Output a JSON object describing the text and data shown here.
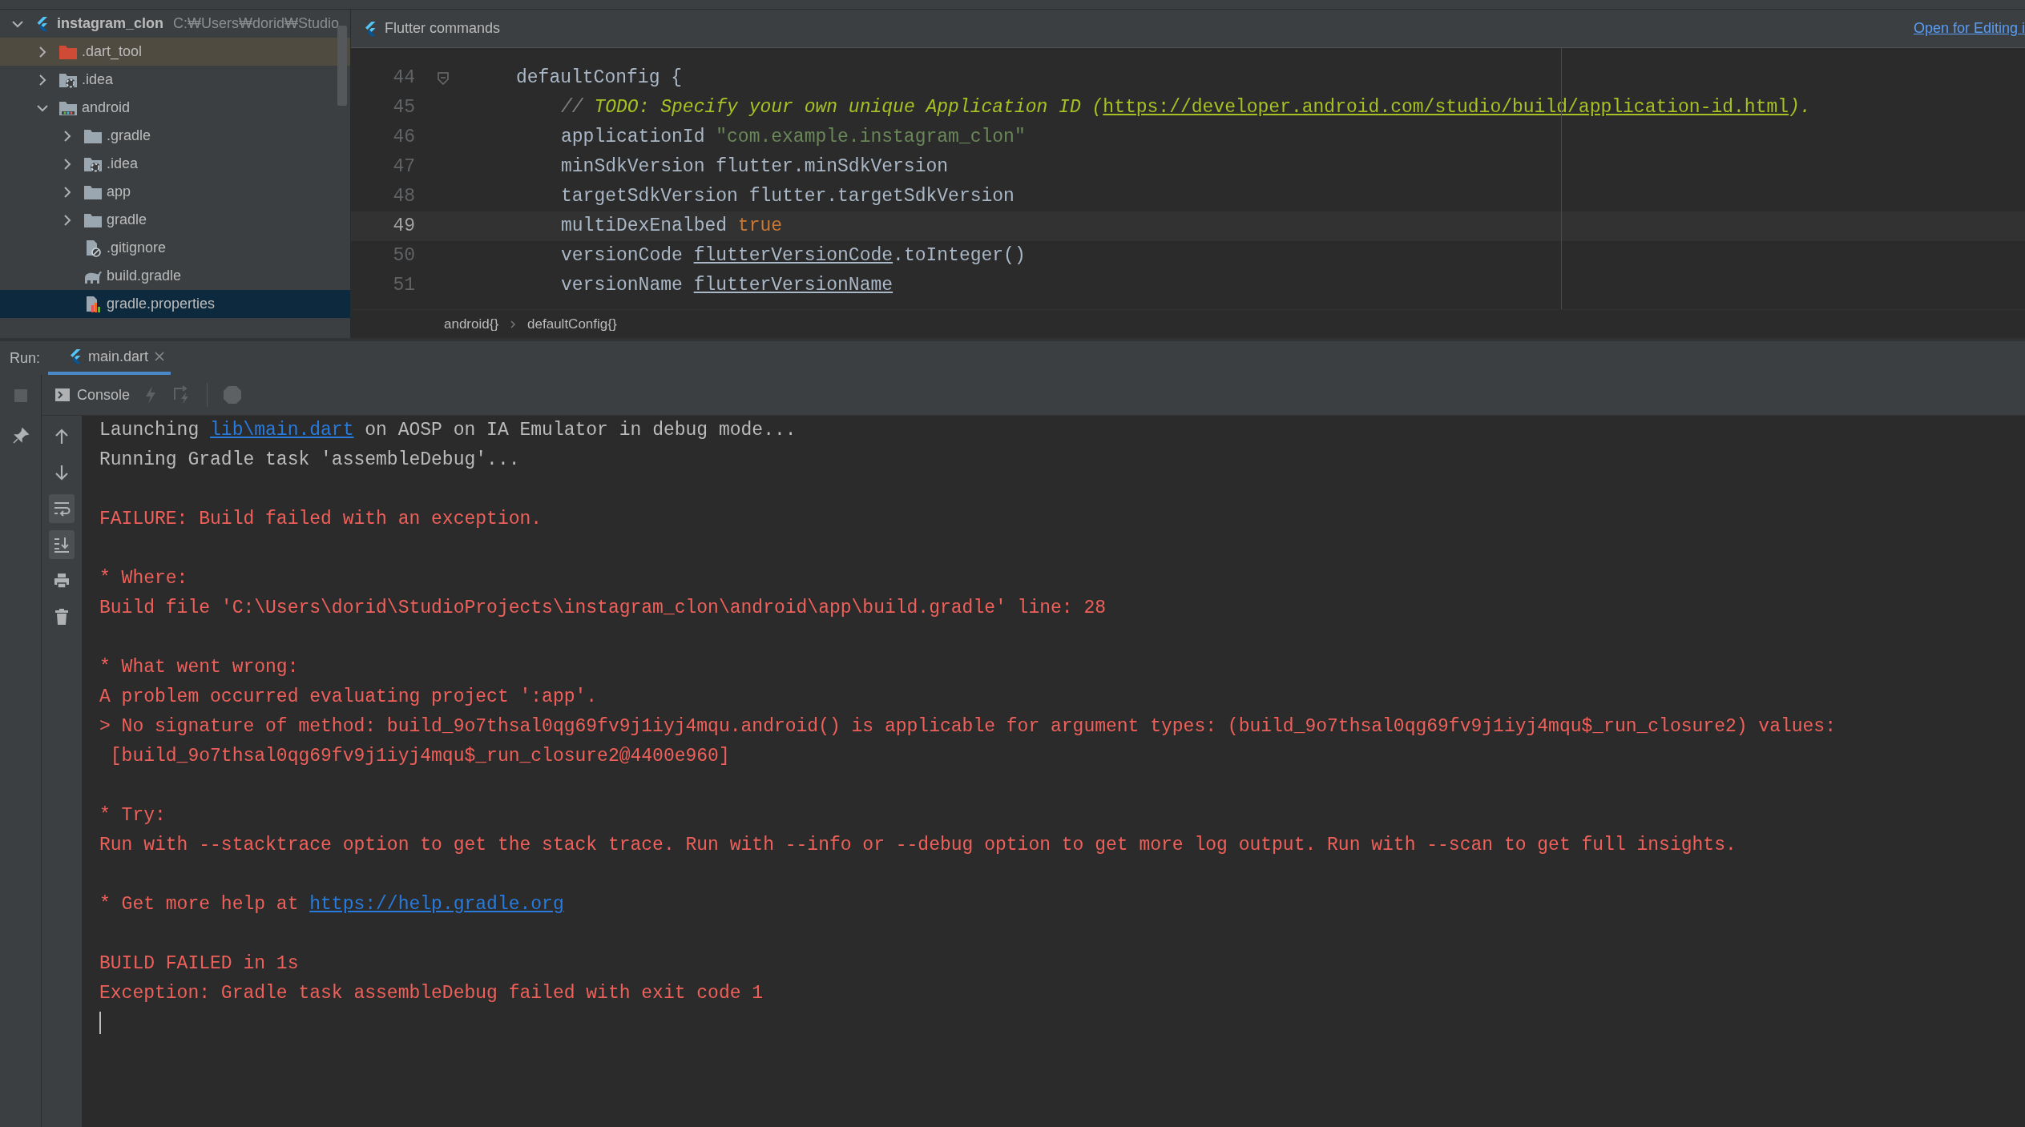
{
  "project_tree": {
    "items": [
      {
        "label": "instagram_clon",
        "path": "C:₩Users₩dorid₩Studio",
        "kind": "flutter",
        "expanded": true,
        "selected": false,
        "ignored": false,
        "children": [
          {
            "label": ".dart_tool",
            "kind": "folder-excluded",
            "expanded": false,
            "selected": false,
            "ignored": true
          },
          {
            "label": ".idea",
            "kind": "folder-idea",
            "expanded": false,
            "selected": false,
            "ignored": false
          },
          {
            "label": "android",
            "kind": "folder-android",
            "expanded": true,
            "selected": false,
            "ignored": false,
            "children": [
              {
                "label": ".gradle",
                "kind": "folder",
                "expanded": false,
                "selected": false,
                "ignored": false
              },
              {
                "label": ".idea",
                "kind": "folder-idea",
                "expanded": false,
                "selected": false,
                "ignored": false
              },
              {
                "label": "app",
                "kind": "folder",
                "expanded": false,
                "selected": false,
                "ignored": false
              },
              {
                "label": "gradle",
                "kind": "folder",
                "expanded": false,
                "selected": false,
                "ignored": false
              },
              {
                "label": ".gitignore",
                "kind": "file-ignore",
                "selected": false,
                "ignored": false
              },
              {
                "label": "build.gradle",
                "kind": "file-gradle",
                "selected": false,
                "ignored": false
              },
              {
                "label": "gradle.properties",
                "kind": "file-properties",
                "selected": true,
                "ignored": false
              }
            ]
          }
        ]
      }
    ]
  },
  "editor": {
    "toolbar": {
      "title": "Flutter commands",
      "action": "Open for Editing i"
    },
    "lines": [
      {
        "number": "44",
        "current": false,
        "fold": true,
        "segments": [
          {
            "kind": "plain",
            "text": "defaultConfig {"
          }
        ],
        "children": [
          {
            "number": "45",
            "current": false,
            "fold": false,
            "segments": [
              {
                "kind": "comment",
                "text": "// "
              },
              {
                "kind": "todo",
                "text": "TODO: Specify your own unique Application ID ("
              },
              {
                "kind": "todo-link",
                "text": "https://developer.android.com/studio/build/application-id.html"
              },
              {
                "kind": "todo",
                "text": ")."
              }
            ]
          },
          {
            "number": "46",
            "current": false,
            "fold": false,
            "segments": [
              {
                "kind": "plain",
                "text": "applicationId "
              },
              {
                "kind": "string",
                "text": "\"com.example.instagram_clon\""
              }
            ]
          },
          {
            "number": "47",
            "current": false,
            "fold": false,
            "segments": [
              {
                "kind": "plain",
                "text": "minSdkVersion flutter.minSdkVersion"
              }
            ]
          },
          {
            "number": "48",
            "current": false,
            "fold": false,
            "segments": [
              {
                "kind": "plain",
                "text": "targetSdkVersion flutter.targetSdkVersion"
              }
            ]
          },
          {
            "number": "49",
            "current": true,
            "fold": false,
            "segments": [
              {
                "kind": "plain",
                "text": "multiDexEnalbed "
              },
              {
                "kind": "keyword",
                "text": "true"
              }
            ]
          },
          {
            "number": "50",
            "current": false,
            "fold": false,
            "segments": [
              {
                "kind": "plain",
                "text": "versionCode "
              },
              {
                "kind": "field",
                "text": "flutterVersionCode"
              },
              {
                "kind": "plain",
                "text": ".toInteger()"
              }
            ]
          },
          {
            "number": "51",
            "current": false,
            "fold": false,
            "segments": [
              {
                "kind": "plain",
                "text": "versionName "
              },
              {
                "kind": "field",
                "text": "flutterVersionName"
              }
            ]
          }
        ]
      }
    ],
    "breadcrumbs": [
      "android{}",
      "defaultConfig{}"
    ]
  },
  "run": {
    "label": "Run:",
    "tabs": [
      {
        "label": "main.dart",
        "selected": true
      }
    ]
  },
  "console": {
    "tab": "Console",
    "side_tools": [
      {
        "kind": "up",
        "on": false
      },
      {
        "kind": "down",
        "on": false
      },
      {
        "kind": "wrap",
        "on": true
      },
      {
        "kind": "scroll-end",
        "on": true
      },
      {
        "kind": "print",
        "on": false
      },
      {
        "kind": "trash",
        "on": false
      }
    ],
    "blocks": [
      [
        {
          "kind": "info",
          "segments": [
            {
              "kind": "text",
              "text": "Launching "
            },
            {
              "kind": "link",
              "text": "lib\\main.dart"
            },
            {
              "kind": "text",
              "text": " on AOSP on IA Emulator in debug mode..."
            }
          ]
        },
        {
          "kind": "info",
          "segments": [
            {
              "kind": "text",
              "text": "Running Gradle task 'assembleDebug'..."
            }
          ]
        }
      ],
      [
        {
          "kind": "error",
          "segments": [
            {
              "kind": "text",
              "text": "FAILURE: Build failed with an exception."
            }
          ]
        }
      ],
      [
        {
          "kind": "error",
          "segments": [
            {
              "kind": "text",
              "text": "* Where:"
            }
          ]
        },
        {
          "kind": "error",
          "segments": [
            {
              "kind": "text",
              "text": "Build file 'C:\\Users\\dorid\\StudioProjects\\instagram_clon\\android\\app\\build.gradle' line: 28"
            }
          ]
        }
      ],
      [
        {
          "kind": "error",
          "segments": [
            {
              "kind": "text",
              "text": "* What went wrong:"
            }
          ]
        },
        {
          "kind": "error",
          "segments": [
            {
              "kind": "text",
              "text": "A problem occurred evaluating project ':app'."
            }
          ]
        },
        {
          "kind": "error",
          "segments": [
            {
              "kind": "text",
              "text": "> No signature of method: build_9o7thsal0qg69fv9j1iyj4mqu.android() is applicable for argument types: (build_9o7thsal0qg69fv9j1iyj4mqu$_run_closure2) values:"
            }
          ]
        },
        {
          "kind": "error",
          "segments": [
            {
              "kind": "text",
              "text": " [build_9o7thsal0qg69fv9j1iyj4mqu$_run_closure2@4400e960]"
            }
          ]
        }
      ],
      [
        {
          "kind": "error",
          "segments": [
            {
              "kind": "text",
              "text": "* Try:"
            }
          ]
        },
        {
          "kind": "error",
          "segments": [
            {
              "kind": "text",
              "text": "Run with --stacktrace option to get the stack trace. Run with --info or --debug option to get more log output. Run with --scan to get full insights."
            }
          ]
        }
      ],
      [
        {
          "kind": "error",
          "segments": [
            {
              "kind": "text",
              "text": "* Get more help at "
            },
            {
              "kind": "link",
              "text": "https://help.gradle.org"
            }
          ]
        }
      ],
      [
        {
          "kind": "error",
          "segments": [
            {
              "kind": "text",
              "text": "BUILD FAILED in 1s"
            }
          ]
        },
        {
          "kind": "error",
          "segments": [
            {
              "kind": "text",
              "text": "Exception: Gradle task assembleDebug failed with exit code 1"
            }
          ]
        }
      ]
    ],
    "cursor": true
  }
}
